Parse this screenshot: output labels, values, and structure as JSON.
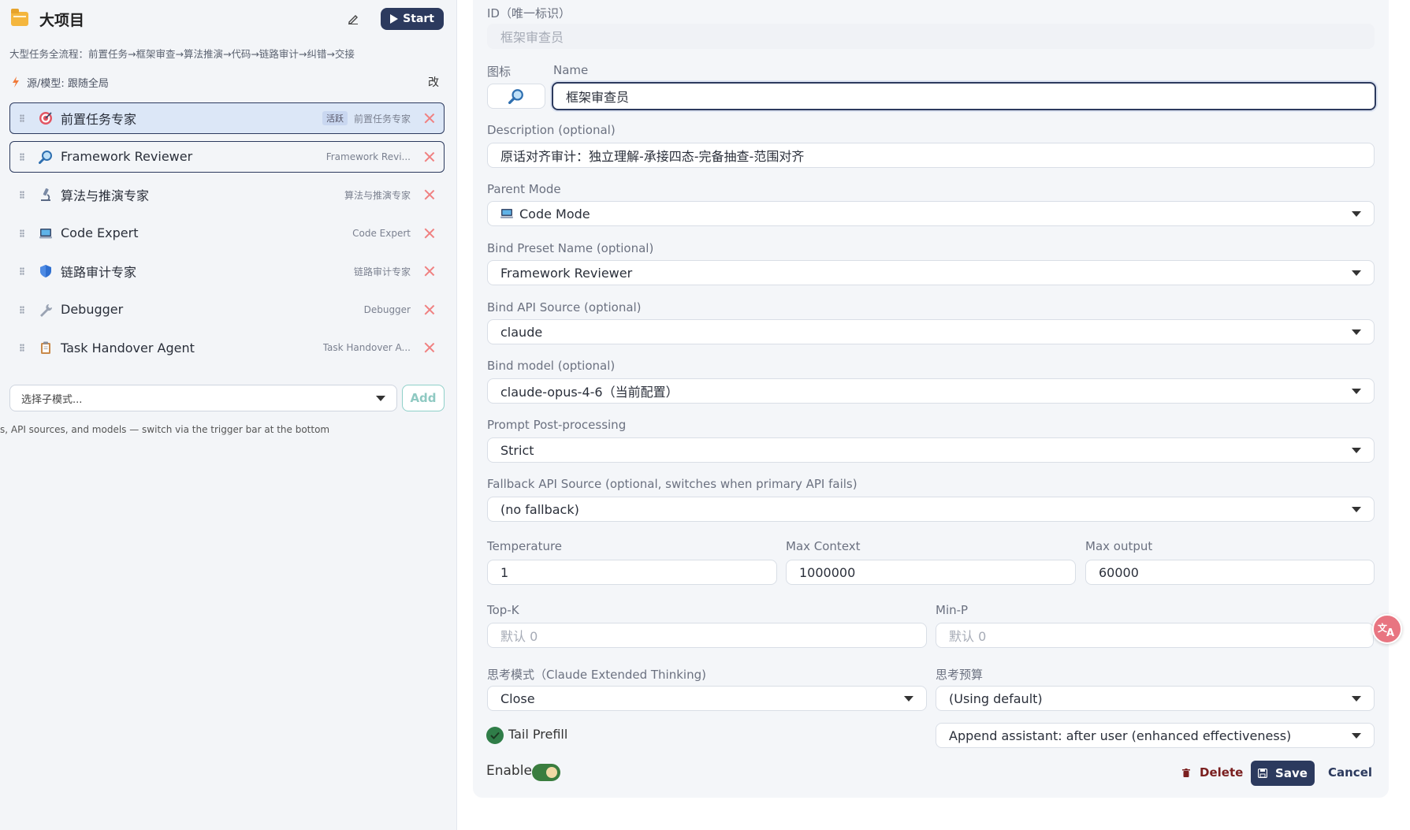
{
  "left_panel": {
    "title": "大项目",
    "start_label": "Start",
    "flow_description": "大型任务全流程：前置任务→框架审查→算法推演→代码→链路审计→纠错→交接",
    "source_model": "源/模型: 跟随全局",
    "change_label": "改",
    "items": [
      {
        "name": "前置任务专家",
        "badge": "活跃",
        "sub": "前置任务专家",
        "icon": "target-icon"
      },
      {
        "name": "Framework Reviewer",
        "badge": "",
        "sub": "Framework Revi...",
        "icon": "magnifier-icon"
      },
      {
        "name": "算法与推演专家",
        "badge": "",
        "sub": "算法与推演专家",
        "icon": "microscope-icon"
      },
      {
        "name": "Code Expert",
        "badge": "",
        "sub": "Code Expert",
        "icon": "laptop-icon"
      },
      {
        "name": "链路审计专家",
        "badge": "",
        "sub": "链路审计专家",
        "icon": "shield-icon"
      },
      {
        "name": "Debugger",
        "badge": "",
        "sub": "Debugger",
        "icon": "wrench-icon"
      },
      {
        "name": "Task Handover Agent",
        "badge": "",
        "sub": "Task Handover A...",
        "icon": "clipboard-icon"
      }
    ],
    "submode_placeholder": "选择子模式...",
    "add_label": "Add",
    "footnote": "s, API sources, and models — switch via the trigger bar at the bottom"
  },
  "form": {
    "id_label": "ID（唯一标识）",
    "id_value": "框架审查员",
    "icon_label": "图标",
    "name_label": "Name",
    "name_value": "框架审查员",
    "description_label": "Description (optional)",
    "description_value": "原话对齐审计：独立理解-承接四态-完备抽查-范围对齐",
    "parent_mode_label": "Parent Mode",
    "parent_mode_value": "Code Mode",
    "bind_preset_label": "Bind Preset Name (optional)",
    "bind_preset_value": "Framework Reviewer",
    "bind_api_label": "Bind API Source (optional)",
    "bind_api_value": "claude",
    "bind_model_label": "Bind model (optional)",
    "bind_model_value": "claude-opus-4-6（当前配置）",
    "prompt_post_label": "Prompt Post-processing",
    "prompt_post_value": "Strict",
    "fallback_label": "Fallback API Source (optional, switches when primary API fails)",
    "fallback_value": "(no fallback)",
    "temperature_label": "Temperature",
    "temperature_value": "1",
    "max_context_label": "Max Context",
    "max_context_value": "1000000",
    "max_output_label": "Max output",
    "max_output_value": "60000",
    "topk_label": "Top-K",
    "topk_placeholder": "默认 0",
    "minp_label": "Min-P",
    "minp_placeholder": "默认 0",
    "thinking_label": "思考模式（Claude Extended Thinking)",
    "thinking_value": "Close",
    "budget_label": "思考预算",
    "budget_value": "(Using default)",
    "tail_prefill_label": "Tail Prefill",
    "tail_prefill_checked": true,
    "append_value": "Append assistant: after user (enhanced effectiveness)",
    "enable_label": "Enable",
    "enable_on": true,
    "delete_label": "Delete",
    "save_label": "Save",
    "cancel_label": "Cancel"
  },
  "colors": {
    "primary": "#2c3a5e",
    "active_bg": "#dce7f7",
    "remove": "#f08080",
    "add_accent": "#8fc9c2",
    "toggle_on": "#3a7d3f",
    "delete": "#7a1f1f",
    "translate_fab": "#e87581"
  },
  "translate_button": "translate-icon"
}
